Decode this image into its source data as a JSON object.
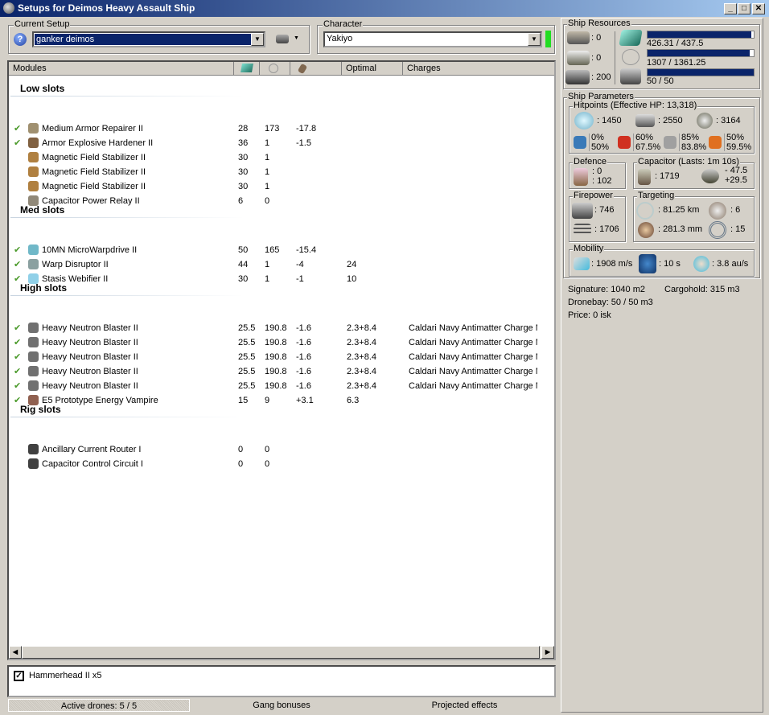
{
  "window": {
    "title": "Setups for Deimos Heavy Assault Ship",
    "buttons": [
      "_",
      "□",
      "✕"
    ]
  },
  "setup": {
    "label": "Current Setup",
    "value": "ganker deimos"
  },
  "character": {
    "label": "Character",
    "value": "Yakiyo",
    "status_color": "#22dd22"
  },
  "columns": {
    "modules": "Modules",
    "optimal": "Optimal",
    "charges": "Charges"
  },
  "sections": [
    {
      "title": "Low slots",
      "rows": [
        {
          "active": true,
          "name": "Medium Armor Repairer II",
          "cpu": "28",
          "pg": "173",
          "cap": "-17.8",
          "optimal": "",
          "charge": "",
          "icon": "armor-repairer-icon",
          "color": "#a09070"
        },
        {
          "active": true,
          "name": "Armor Explosive Hardener II",
          "cpu": "36",
          "pg": "1",
          "cap": "-1.5",
          "optimal": "",
          "charge": "",
          "icon": "hardener-icon",
          "color": "#806040"
        },
        {
          "active": false,
          "name": "Magnetic Field Stabilizer II",
          "cpu": "30",
          "pg": "1",
          "cap": "",
          "optimal": "",
          "charge": "",
          "icon": "stabilizer-icon",
          "color": "#b08040"
        },
        {
          "active": false,
          "name": "Magnetic Field Stabilizer II",
          "cpu": "30",
          "pg": "1",
          "cap": "",
          "optimal": "",
          "charge": "",
          "icon": "stabilizer-icon",
          "color": "#b08040"
        },
        {
          "active": false,
          "name": "Magnetic Field Stabilizer II",
          "cpu": "30",
          "pg": "1",
          "cap": "",
          "optimal": "",
          "charge": "",
          "icon": "stabilizer-icon",
          "color": "#b08040"
        },
        {
          "active": false,
          "name": "Capacitor Power Relay II",
          "cpu": "6",
          "pg": "0",
          "cap": "",
          "optimal": "",
          "charge": "",
          "icon": "power-relay-icon",
          "color": "#908878"
        }
      ]
    },
    {
      "title": "Med slots",
      "rows": [
        {
          "active": true,
          "name": "10MN MicroWarpdrive II",
          "cpu": "50",
          "pg": "165",
          "cap": "-15.4",
          "optimal": "",
          "charge": "",
          "icon": "microwarpdrive-icon",
          "color": "#70b8c8"
        },
        {
          "active": true,
          "name": "Warp Disruptor II",
          "cpu": "44",
          "pg": "1",
          "cap": "-4",
          "optimal": "24",
          "charge": "",
          "icon": "warp-disruptor-icon",
          "color": "#8aa0a0"
        },
        {
          "active": true,
          "name": "Stasis Webifier II",
          "cpu": "30",
          "pg": "1",
          "cap": "-1",
          "optimal": "10",
          "charge": "",
          "icon": "webifier-icon",
          "color": "#90d0e8"
        }
      ]
    },
    {
      "title": "High slots",
      "rows": [
        {
          "active": true,
          "name": "Heavy Neutron Blaster II",
          "cpu": "25.5",
          "pg": "190.8",
          "cap": "-1.6",
          "optimal": "2.3+8.4",
          "charge": "Caldari Navy Antimatter Charge M",
          "icon": "blaster-icon",
          "color": "#707070"
        },
        {
          "active": true,
          "name": "Heavy Neutron Blaster II",
          "cpu": "25.5",
          "pg": "190.8",
          "cap": "-1.6",
          "optimal": "2.3+8.4",
          "charge": "Caldari Navy Antimatter Charge M",
          "icon": "blaster-icon",
          "color": "#707070"
        },
        {
          "active": true,
          "name": "Heavy Neutron Blaster II",
          "cpu": "25.5",
          "pg": "190.8",
          "cap": "-1.6",
          "optimal": "2.3+8.4",
          "charge": "Caldari Navy Antimatter Charge M",
          "icon": "blaster-icon",
          "color": "#707070"
        },
        {
          "active": true,
          "name": "Heavy Neutron Blaster II",
          "cpu": "25.5",
          "pg": "190.8",
          "cap": "-1.6",
          "optimal": "2.3+8.4",
          "charge": "Caldari Navy Antimatter Charge M",
          "icon": "blaster-icon",
          "color": "#707070"
        },
        {
          "active": true,
          "name": "Heavy Neutron Blaster II",
          "cpu": "25.5",
          "pg": "190.8",
          "cap": "-1.6",
          "optimal": "2.3+8.4",
          "charge": "Caldari Navy Antimatter Charge M",
          "icon": "blaster-icon",
          "color": "#707070"
        },
        {
          "active": true,
          "name": "E5 Prototype Energy Vampire",
          "cpu": "15",
          "pg": "9",
          "cap": "+3.1",
          "optimal": "6.3",
          "charge": "",
          "icon": "energy-vampire-icon",
          "color": "#906050"
        }
      ]
    },
    {
      "title": "Rig slots",
      "rows": [
        {
          "active": false,
          "name": "Ancillary Current Router I",
          "cpu": "0",
          "pg": "0",
          "cap": "",
          "optimal": "",
          "charge": "",
          "icon": "rig-icon",
          "color": "#404040"
        },
        {
          "active": false,
          "name": "Capacitor Control Circuit I",
          "cpu": "0",
          "pg": "0",
          "cap": "",
          "optimal": "",
          "charge": "",
          "icon": "rig-icon",
          "color": "#404040"
        }
      ]
    }
  ],
  "drones": {
    "items": [
      {
        "checked": true,
        "label": "Hammerhead II x5"
      }
    ]
  },
  "bottom_tabs": {
    "active_drones": "Active drones: 5 / 5",
    "gang": "Gang bonuses",
    "projected": "Projected effects"
  },
  "resources": {
    "label": "Ship Resources",
    "turrets": ": 0",
    "launchers": ": 0",
    "calibration": ": 200",
    "cpu": {
      "text": "426.31 / 437.5",
      "fraction": 0.9744
    },
    "powergrid": {
      "text": "1307 / 1361.25",
      "fraction": 0.9601
    },
    "drone_bandwidth": {
      "text": "50 / 50",
      "fraction": 1.0
    }
  },
  "parameters": {
    "label": "Ship Parameters",
    "hitpoints": {
      "label": "Hitpoints (Effective HP: 13,318)",
      "shield": ": 1450",
      "armor": ": 2550",
      "structure": ": 3164",
      "resists": [
        {
          "a": "0%",
          "b": "50%",
          "icon": "em-resist-icon",
          "color": "#3a7ab8"
        },
        {
          "a": "60%",
          "b": "67.5%",
          "icon": "thermal-resist-icon",
          "color": "#d03020"
        },
        {
          "a": "85%",
          "b": "83.8%",
          "icon": "kinetic-resist-icon",
          "color": "#a0a0a0"
        },
        {
          "a": "50%",
          "b": "59.5%",
          "icon": "explosive-resist-icon",
          "color": "#e07020"
        }
      ]
    },
    "defence": {
      "label": "Defence",
      "top": ": 0",
      "bottom": ": 102"
    },
    "capacitor": {
      "label": "Capacitor (Lasts: 1m 10s)",
      "capacity": ": 1719",
      "use": "- 47.5",
      "recharge": "+29.5"
    },
    "firepower": {
      "label": "Firepower",
      "dps": ": 746",
      "volley": ": 1706"
    },
    "targeting": {
      "label": "Targeting",
      "range": ": 81.25 km",
      "max_targets": ": 6",
      "resolution": ": 281.3 mm",
      "sensor": ": 15"
    },
    "mobility": {
      "label": "Mobility",
      "speed": ": 1908 m/s",
      "align": ": 10 s",
      "warp": ": 3.8 au/s"
    },
    "signature": "Signature: 1040 m2",
    "cargohold": "Cargohold: 315 m3",
    "dronebay": "Dronebay: 50 / 50 m3",
    "price": "Price: 0 isk"
  }
}
